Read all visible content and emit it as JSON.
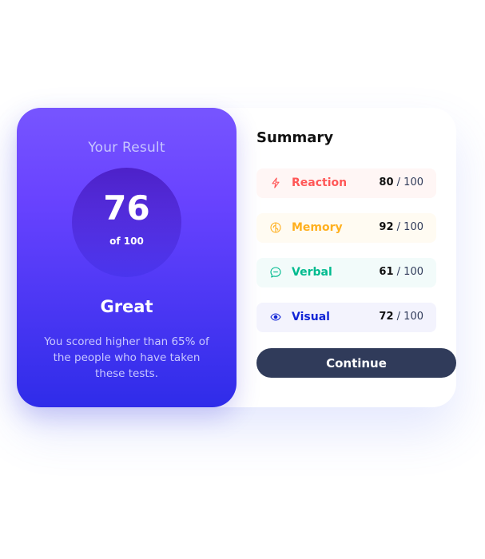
{
  "result": {
    "heading": "Your Result",
    "score": "76",
    "score_max": "of 100",
    "rating": "Great",
    "description": "You scored higher than 65% of the people who have taken these tests."
  },
  "summary": {
    "title": "Summary",
    "items": [
      {
        "label": "Reaction",
        "score": "80",
        "max": "100",
        "icon": "lightning-icon",
        "color": "#ff5757",
        "bg": "#fff6f5"
      },
      {
        "label": "Memory",
        "score": "92",
        "max": "100",
        "icon": "brain-icon",
        "color": "#ffb01f",
        "bg": "#fffbf2"
      },
      {
        "label": "Verbal",
        "score": "61",
        "max": "100",
        "icon": "chat-bubble-icon",
        "color": "#00bb8f",
        "bg": "#f2fbfa"
      },
      {
        "label": "Visual",
        "score": "72",
        "max": "100",
        "icon": "eye-icon",
        "color": "#1125d6",
        "bg": "#f3f3fd"
      }
    ],
    "separator": "/"
  },
  "actions": {
    "continue_label": "Continue"
  }
}
